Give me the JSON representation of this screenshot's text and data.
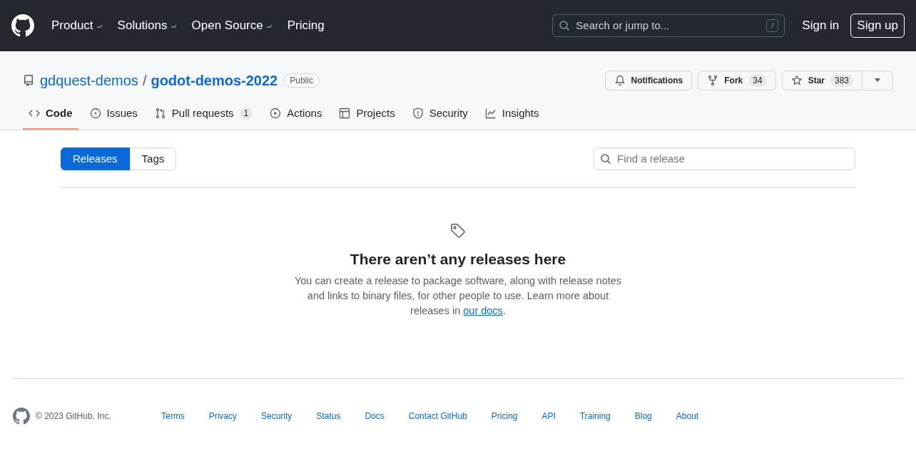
{
  "header": {
    "nav": [
      {
        "label": "Product",
        "dropdown": true
      },
      {
        "label": "Solutions",
        "dropdown": true
      },
      {
        "label": "Open Source",
        "dropdown": true
      },
      {
        "label": "Pricing",
        "dropdown": false
      }
    ],
    "search": {
      "placeholder": "Search or jump to...",
      "shortcut": "/"
    },
    "sign_in": "Sign in",
    "sign_up": "Sign up"
  },
  "repo": {
    "owner": "gdquest-demos",
    "separator": "/",
    "name": "godot-demos-2022",
    "visibility": "Public",
    "actions": [
      {
        "kind": "notifications",
        "label": "Notifications"
      },
      {
        "kind": "fork",
        "label": "Fork",
        "count": "34"
      },
      {
        "kind": "star",
        "label": "Star",
        "count": "383"
      }
    ]
  },
  "tabs": [
    {
      "kind": "code",
      "label": "Code",
      "selected": true
    },
    {
      "kind": "issues",
      "label": "Issues",
      "selected": false
    },
    {
      "kind": "pulls",
      "label": "Pull requests",
      "count": "1",
      "selected": false
    },
    {
      "kind": "actions",
      "label": "Actions",
      "selected": false
    },
    {
      "kind": "projects",
      "label": "Projects",
      "selected": false
    },
    {
      "kind": "security",
      "label": "Security",
      "selected": false
    },
    {
      "kind": "insights",
      "label": "Insights",
      "selected": false
    }
  ],
  "toggle": [
    {
      "label": "Releases",
      "selected": true
    },
    {
      "label": "Tags",
      "selected": false
    }
  ],
  "release_search": {
    "placeholder": "Find a release"
  },
  "empty": {
    "title": "There aren’t any releases here",
    "text": "You can create a release to package software, along with release notes and links to binary files, for other people to use. Learn more about releases in ",
    "link": "our docs",
    "after": "."
  },
  "footer": {
    "copyright": "© 2023 GitHub, Inc.",
    "links": [
      "Terms",
      "Privacy",
      "Security",
      "Status",
      "Docs",
      "Contact GitHub",
      "Pricing",
      "API",
      "Training",
      "Blog",
      "About"
    ]
  }
}
